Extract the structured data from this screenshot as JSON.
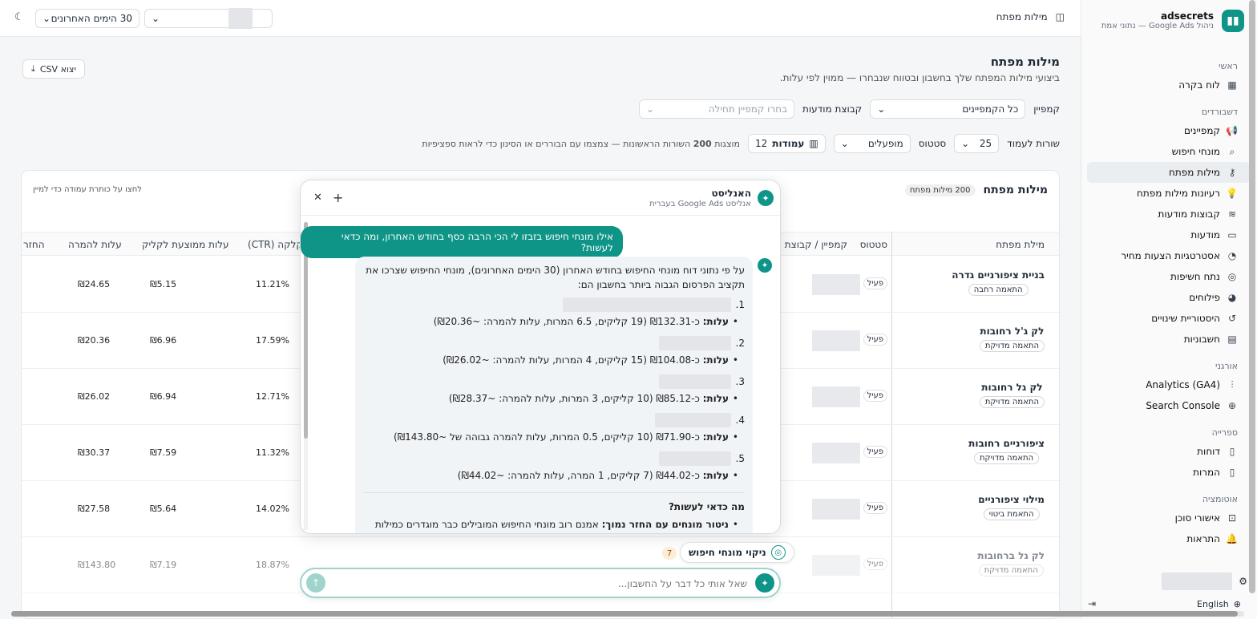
{
  "brand": {
    "name": "adsecrets",
    "sub": "ניהול Google Ads — נתוני אמת"
  },
  "sidebar": {
    "sections": [
      {
        "label": "ראשי",
        "items": [
          {
            "label": "לוח בקרה",
            "icon": "grid-icon"
          }
        ]
      },
      {
        "label": "דשבורדים",
        "items": [
          {
            "label": "קמפיינים",
            "icon": "megaphone-icon"
          },
          {
            "label": "מונחי חיפוש",
            "icon": "search-icon"
          },
          {
            "label": "מילות מפתח",
            "icon": "key-icon",
            "active": true
          },
          {
            "label": "רעיונות מילות מפתח",
            "icon": "bulb-icon"
          },
          {
            "label": "קבוצות מודעות",
            "icon": "layers-icon"
          },
          {
            "label": "מודעות",
            "icon": "ad-icon"
          },
          {
            "label": "אסטרטגיות הצעות מחיר",
            "icon": "gauge-icon"
          },
          {
            "label": "נתח חשיפות",
            "icon": "target-icon"
          },
          {
            "label": "פילוחים",
            "icon": "pie-icon"
          },
          {
            "label": "היסטוריית שינויים",
            "icon": "history-icon"
          },
          {
            "label": "חשבוניות",
            "icon": "invoice-icon"
          }
        ]
      },
      {
        "label": "אורגני",
        "items": [
          {
            "label": "Analytics (GA4)",
            "icon": "chart-icon"
          },
          {
            "label": "Search Console",
            "icon": "globe-icon"
          }
        ]
      },
      {
        "label": "ספרייה",
        "items": [
          {
            "label": "דוחות",
            "icon": "file-icon"
          },
          {
            "label": "המרות",
            "icon": "file-icon"
          }
        ]
      },
      {
        "label": "אוטומציה",
        "items": [
          {
            "label": "אישורי סוכן",
            "icon": "inbox-icon"
          },
          {
            "label": "התראות",
            "icon": "bell-icon"
          }
        ]
      }
    ],
    "language": "English"
  },
  "topbar": {
    "title": "מילות מפתח",
    "date_range": "30 הימים האחרונים"
  },
  "page": {
    "title": "מילות מפתח",
    "subtitle": "ביצועי מילות המפתח שלך בחשבון ובטווח שנבחרו — ממוין לפי עלות.",
    "export_label": "יצוא CSV",
    "campaign_label": "קמפיין",
    "campaign_value": "כל הקמפיינים",
    "adgroup_label": "קבוצת מודעות",
    "adgroup_placeholder": "בחרו קמפיין תחילה",
    "rows_label": "שורות לעמוד",
    "rows_value": "25",
    "status_label": "סטטוס",
    "status_value": "מופעלים",
    "columns_label": "עמודות",
    "columns_count": "12",
    "showing_prefix": "מוצגות",
    "showing_count": "200",
    "showing_suffix": "השורות הראשונות — צמצמו עם הבוררים או הסינון כדי לראות ספציפיות"
  },
  "table": {
    "title": "מילות מפתח",
    "count_badge": "200 מילות מפתח",
    "sort_hint": "לחצו על כותרת עמודה כדי למיין",
    "headers": {
      "keyword": "מילת מפתח",
      "status": "סטטוס",
      "campaign": "קמפיין / קבוצת מ",
      "ctr": "הקלקה (CTR)",
      "cpc": "עלות ממוצעת לקליק",
      "cpa": "עלות להמרה",
      "roas": "החזר"
    },
    "rows": [
      {
        "keyword": "בניית ציפורניים גדרה",
        "match": "התאמה רחבה",
        "status": "פעיל",
        "ctr": "11.21%",
        "cpc": "₪5.15",
        "cpa": "₪24.65"
      },
      {
        "keyword": "לק ג'ל רחובות",
        "match": "התאמה מדויקת",
        "status": "פעיל",
        "ctr": "17.59%",
        "cpc": "₪6.96",
        "cpa": "₪20.36"
      },
      {
        "keyword": "לק גל רחובות",
        "match": "התאמה מדויקת",
        "status": "פעיל",
        "ctr": "12.71%",
        "cpc": "₪6.94",
        "cpa": "₪26.02"
      },
      {
        "keyword": "ציפורניים רחובות",
        "match": "התאמה מדויקת",
        "status": "פעיל",
        "ctr": "11.32%",
        "cpc": "₪7.59",
        "cpa": "₪30.37"
      },
      {
        "keyword": "מילוי ציפורניים",
        "match": "התאמת ביטוי",
        "status": "פעיל",
        "ctr": "14.02%",
        "cpc": "₪5.64",
        "cpa": "₪27.58"
      },
      {
        "keyword": "לק גל ברחובות",
        "match": "התאמה מדויקת",
        "status": "פעיל",
        "ctr": "18.87%",
        "cpc": "₪7.19",
        "cpa": "₪143.80"
      }
    ]
  },
  "chat": {
    "title": "האנליסט",
    "subtitle": "אנליסט Google Ads בעברית",
    "user_message": "אילו מונחי חיפוש בזבזו לי הכי הרבה כסף בחודש האחרון, ומה כדאי לעשות?",
    "intro": "על פי נתוני דוח מונחי החיפוש בחודש האחרון (30 הימים האחרונים), מונחי החיפוש שצרכו את תקציב הפרסום הגבוה ביותר בחשבון הם:",
    "cost_label": "עלות:",
    "items": [
      {
        "num": "1.",
        "detail": "כ-₪132.31 (19 קליקים, 6.5 המרות, עלות להמרה: ~₪20.36)"
      },
      {
        "num": "2.",
        "detail": "כ-₪104.08 (15 קליקים, 4 המרות, עלות להמרה: ~₪26.02)"
      },
      {
        "num": "3.",
        "detail": "כ-₪85.12 (10 קליקים, 3 המרות, עלות להמרה: ~₪28.37)"
      },
      {
        "num": "4.",
        "detail": "כ-₪71.90 (10 קליקים, 0.5 המרות, עלות להמרה גבוהה של ~₪143.80)"
      },
      {
        "num": "5.",
        "detail": "כ-₪44.02 (7 קליקים, 1 המרה, עלות להמרה: ~₪44.02)"
      }
    ],
    "what_todo": "מה כדאי לעשות?",
    "todo_bold": "ניטור מונחים עם החזר נמוך:",
    "todo_text": "אמנם רוב מונחי החיפוש המובילים כבר מוגדרים כמילות מפתח",
    "chip_label": "ניקוי מונחי חיפוש",
    "chip_count": "7",
    "input_placeholder": "שאל אותי כל דבר על החשבון..."
  }
}
